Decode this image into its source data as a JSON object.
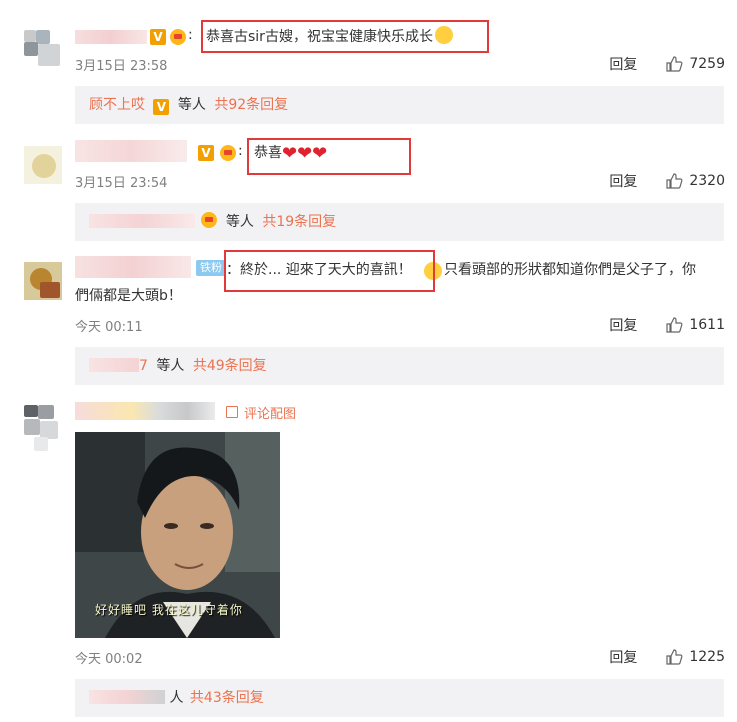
{
  "comments": [
    {
      "text": "恭喜古sir古嫂，祝宝宝健康快乐成长",
      "time": "3月15日 23:58",
      "reply_label": "回复",
      "likes": "7259",
      "thread": {
        "name": "顾不上哎",
        "mid": "等人",
        "count": "共92条回复"
      }
    },
    {
      "text": "恭喜",
      "time": "3月15日 23:54",
      "reply_label": "回复",
      "likes": "2320",
      "thread": {
        "mid": "等人",
        "count": "共19条回复"
      }
    },
    {
      "fan_badge": "铁粉",
      "text_a": "：終於... 迎來了天大的喜訊！",
      "text_b": " 只看頭部的形狀都知道你們是父子了，你",
      "text_c": "們倆都是大頭b！",
      "time": "今天 00:11",
      "reply_label": "回复",
      "likes": "1611",
      "thread": {
        "name_tail": "7",
        "mid": "等人",
        "count": "共49条回复"
      }
    },
    {
      "image_label": "评论配图",
      "photo_caption": "好好睡吧  我在这儿守着你",
      "time": "今天 00:02",
      "reply_label": "回复",
      "likes": "1225",
      "thread": {
        "mid": "人",
        "count": "共43条回复"
      }
    }
  ],
  "badges": {
    "v": "V"
  },
  "colors": {
    "accent": "#eb7350",
    "highlight_box": "#e23a3a",
    "reply_bg": "#f2f2f5"
  }
}
